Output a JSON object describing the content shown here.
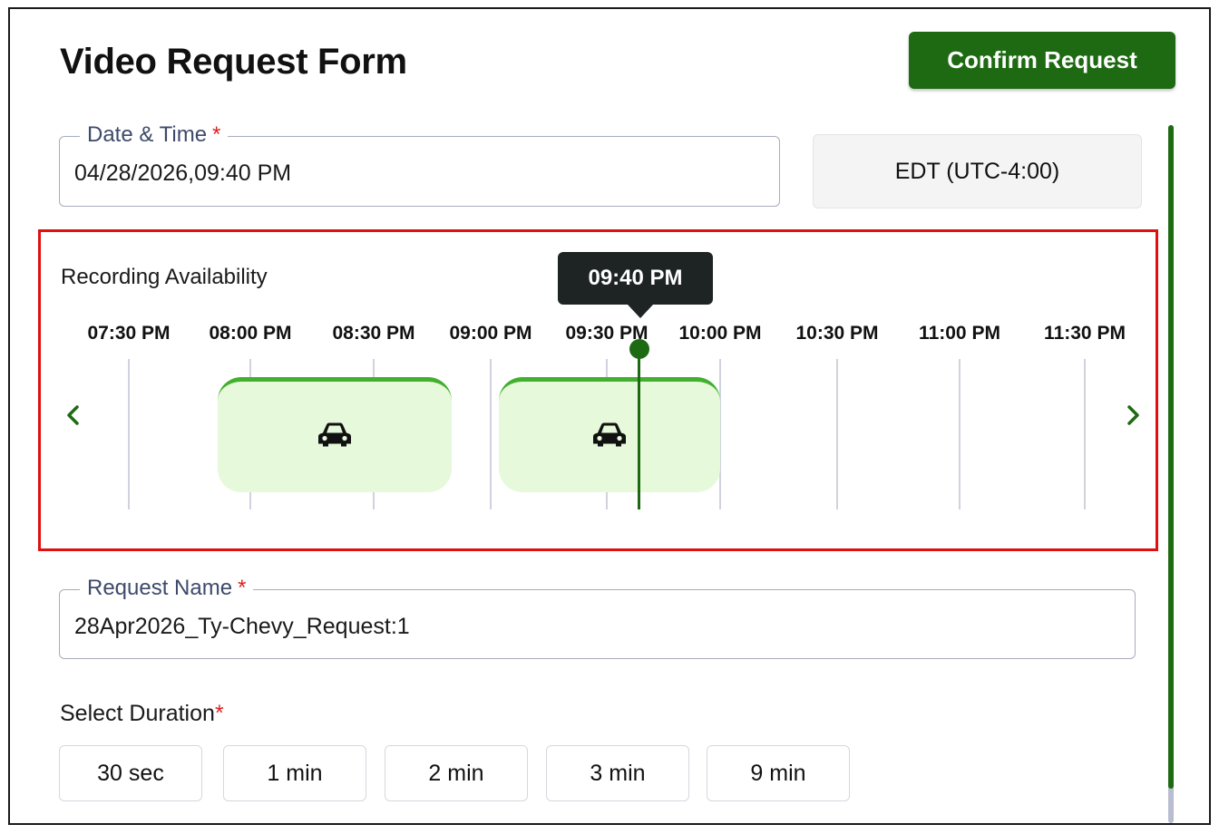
{
  "form": {
    "title": "Video Request Form",
    "confirm_label": "Confirm Request"
  },
  "date_time": {
    "label": "Date & Time",
    "required_mark": "*",
    "value": "04/28/2026,09:40 PM"
  },
  "timezone": {
    "value": "EDT (UTC-4:00)"
  },
  "availability": {
    "label": "Recording Availability",
    "ticks": [
      "07:30 PM",
      "08:00 PM",
      "08:30 PM",
      "09:00 PM",
      "09:30 PM",
      "10:00 PM",
      "10:30 PM",
      "11:00 PM",
      "11:30 PM"
    ],
    "selected_time": "09:40 PM",
    "recordings": [
      {
        "start": "07:52 PM",
        "end": "08:50 PM",
        "icon": "car-icon"
      },
      {
        "start": "09:02 PM",
        "end": "10:00 PM",
        "icon": "car-icon"
      }
    ],
    "prev_icon": "chevron-left-icon",
    "next_icon": "chevron-right-icon"
  },
  "request_name": {
    "label": "Request Name",
    "required_mark": "*",
    "value": "28Apr2026_Ty-Chevy_Request:1"
  },
  "duration": {
    "label": "Select Duration",
    "required_mark": "*",
    "options": [
      "30 sec",
      "1 min",
      "2 min",
      "3 min",
      "9 min"
    ]
  },
  "colors": {
    "brand_green": "#1e6a12",
    "recording_fill": "#e6f9da",
    "recording_border": "#42b02e",
    "highlight_border": "#e01010",
    "required": "#e02020"
  }
}
